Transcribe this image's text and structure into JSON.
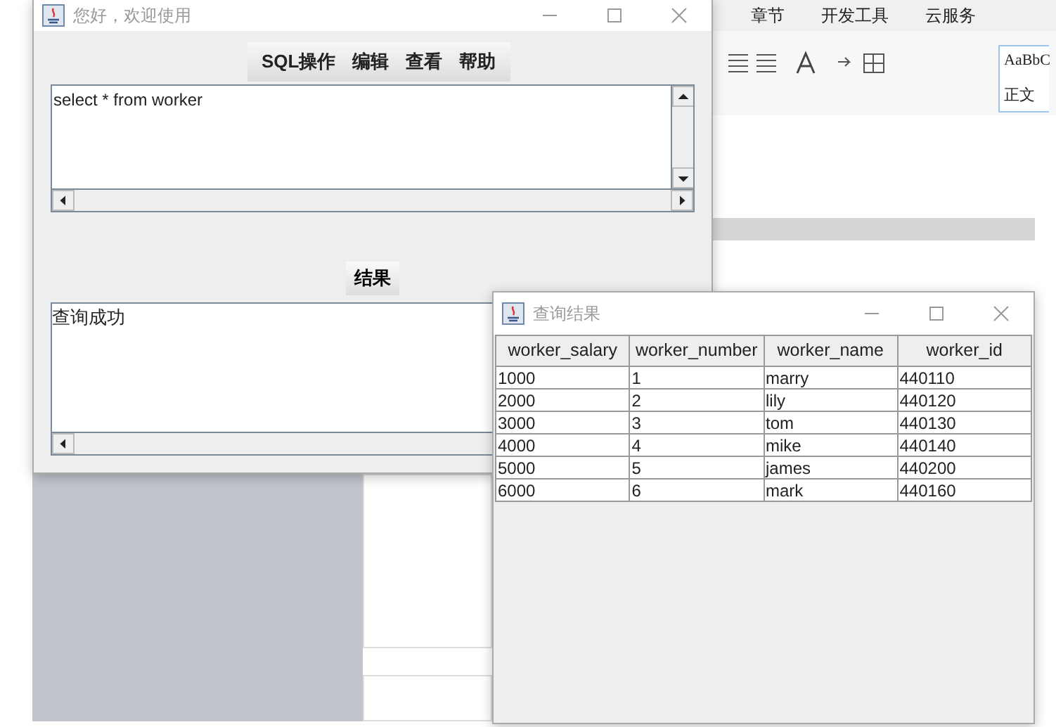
{
  "background_app": {
    "menus": [
      "章节",
      "开发工具",
      "云服务"
    ],
    "style_samples": [
      "AaBbC",
      "正文"
    ]
  },
  "main_window": {
    "title": "您好，欢迎使用",
    "menus": [
      "SQL操作",
      "编辑",
      "查看",
      "帮助"
    ],
    "query": "select * from worker",
    "result_button": "结果",
    "message": "查询成功"
  },
  "result_window": {
    "title": "查询结果",
    "columns": [
      "worker_salary",
      "worker_number",
      "worker_name",
      "worker_id"
    ],
    "rows": [
      [
        "1000",
        "1",
        "marry",
        "440110"
      ],
      [
        "2000",
        "2",
        "lily",
        "440120"
      ],
      [
        "3000",
        "3",
        "tom",
        "440130"
      ],
      [
        "4000",
        "4",
        "mike",
        "440140"
      ],
      [
        "5000",
        "5",
        "james",
        "440200"
      ],
      [
        "6000",
        "6",
        "mark",
        "440160"
      ]
    ]
  }
}
